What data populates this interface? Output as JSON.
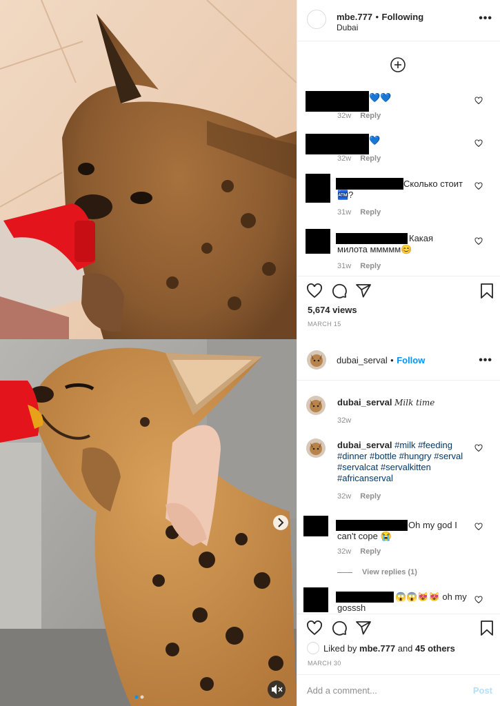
{
  "post1": {
    "header": {
      "username": "mbe.777",
      "separator": "•",
      "status": "Following",
      "location": "Dubai"
    },
    "comments": [
      {
        "text": "💙💙",
        "time": "32w",
        "reply": "Reply"
      },
      {
        "text": "💙",
        "time": "32w",
        "reply": "Reply"
      },
      {
        "text": "Сколько стоит 🏧?",
        "time": "31w",
        "reply": "Reply"
      },
      {
        "text": "Какая милота ммммм😊",
        "time": "31w",
        "reply": "Reply"
      }
    ],
    "views": "5,674 views",
    "date": "MARCH 15"
  },
  "post2": {
    "header": {
      "username": "dubai_serval",
      "separator": "•",
      "follow": "Follow"
    },
    "caption": {
      "username": "dubai_serval",
      "text": "𝑀𝑖𝑙𝑘 𝑡𝑖𝑚𝑒",
      "time": "32w"
    },
    "hashtag_comment": {
      "username": "dubai_serval",
      "tags": "#milk #feeding #dinner #bottle #hungry #serval #servalcat #servalkitten #africanserval",
      "time": "32w",
      "reply": "Reply"
    },
    "comment3": {
      "text": "Oh my god I can't cope 😭",
      "time": "32w",
      "reply": "Reply"
    },
    "view_replies": "View replies (1)",
    "comment4": {
      "text": "😱😱😻😻 oh my gosssh"
    },
    "liked_by": {
      "prefix": "Liked by",
      "user": "mbe.777",
      "and": "and",
      "others": "45 others"
    },
    "date": "MARCH 30",
    "add_comment": {
      "placeholder": "Add a comment...",
      "post": "Post"
    }
  },
  "icons": {
    "heart": "heart-icon",
    "comment": "comment-icon",
    "share": "share-icon",
    "save": "bookmark-icon",
    "more": "more-icon",
    "plus": "plus-circle-icon",
    "mute": "mute-icon",
    "next": "chevron-right-icon"
  },
  "colors": {
    "link": "#0095f6",
    "text": "#262626",
    "muted": "#8e8e8e",
    "hashtag": "#00376b"
  }
}
